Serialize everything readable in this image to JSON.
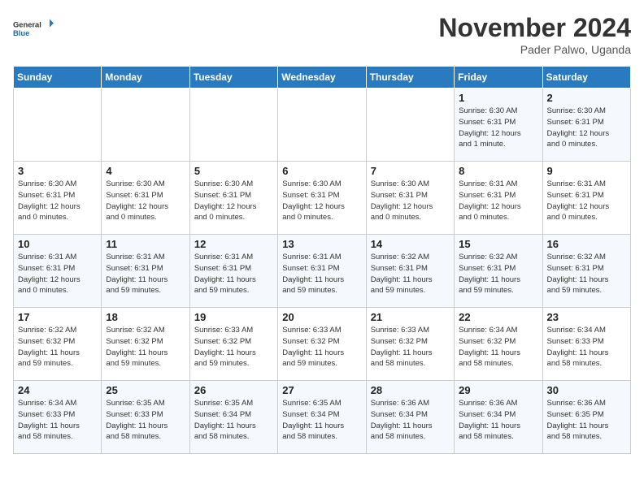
{
  "header": {
    "logo_line1": "General",
    "logo_line2": "Blue",
    "month_title": "November 2024",
    "subtitle": "Pader Palwo, Uganda"
  },
  "weekdays": [
    "Sunday",
    "Monday",
    "Tuesday",
    "Wednesday",
    "Thursday",
    "Friday",
    "Saturday"
  ],
  "weeks": [
    [
      {
        "day": "",
        "info": ""
      },
      {
        "day": "",
        "info": ""
      },
      {
        "day": "",
        "info": ""
      },
      {
        "day": "",
        "info": ""
      },
      {
        "day": "",
        "info": ""
      },
      {
        "day": "1",
        "info": "Sunrise: 6:30 AM\nSunset: 6:31 PM\nDaylight: 12 hours\nand 1 minute."
      },
      {
        "day": "2",
        "info": "Sunrise: 6:30 AM\nSunset: 6:31 PM\nDaylight: 12 hours\nand 0 minutes."
      }
    ],
    [
      {
        "day": "3",
        "info": "Sunrise: 6:30 AM\nSunset: 6:31 PM\nDaylight: 12 hours\nand 0 minutes."
      },
      {
        "day": "4",
        "info": "Sunrise: 6:30 AM\nSunset: 6:31 PM\nDaylight: 12 hours\nand 0 minutes."
      },
      {
        "day": "5",
        "info": "Sunrise: 6:30 AM\nSunset: 6:31 PM\nDaylight: 12 hours\nand 0 minutes."
      },
      {
        "day": "6",
        "info": "Sunrise: 6:30 AM\nSunset: 6:31 PM\nDaylight: 12 hours\nand 0 minutes."
      },
      {
        "day": "7",
        "info": "Sunrise: 6:30 AM\nSunset: 6:31 PM\nDaylight: 12 hours\nand 0 minutes."
      },
      {
        "day": "8",
        "info": "Sunrise: 6:31 AM\nSunset: 6:31 PM\nDaylight: 12 hours\nand 0 minutes."
      },
      {
        "day": "9",
        "info": "Sunrise: 6:31 AM\nSunset: 6:31 PM\nDaylight: 12 hours\nand 0 minutes."
      }
    ],
    [
      {
        "day": "10",
        "info": "Sunrise: 6:31 AM\nSunset: 6:31 PM\nDaylight: 12 hours\nand 0 minutes."
      },
      {
        "day": "11",
        "info": "Sunrise: 6:31 AM\nSunset: 6:31 PM\nDaylight: 11 hours\nand 59 minutes."
      },
      {
        "day": "12",
        "info": "Sunrise: 6:31 AM\nSunset: 6:31 PM\nDaylight: 11 hours\nand 59 minutes."
      },
      {
        "day": "13",
        "info": "Sunrise: 6:31 AM\nSunset: 6:31 PM\nDaylight: 11 hours\nand 59 minutes."
      },
      {
        "day": "14",
        "info": "Sunrise: 6:32 AM\nSunset: 6:31 PM\nDaylight: 11 hours\nand 59 minutes."
      },
      {
        "day": "15",
        "info": "Sunrise: 6:32 AM\nSunset: 6:31 PM\nDaylight: 11 hours\nand 59 minutes."
      },
      {
        "day": "16",
        "info": "Sunrise: 6:32 AM\nSunset: 6:31 PM\nDaylight: 11 hours\nand 59 minutes."
      }
    ],
    [
      {
        "day": "17",
        "info": "Sunrise: 6:32 AM\nSunset: 6:32 PM\nDaylight: 11 hours\nand 59 minutes."
      },
      {
        "day": "18",
        "info": "Sunrise: 6:32 AM\nSunset: 6:32 PM\nDaylight: 11 hours\nand 59 minutes."
      },
      {
        "day": "19",
        "info": "Sunrise: 6:33 AM\nSunset: 6:32 PM\nDaylight: 11 hours\nand 59 minutes."
      },
      {
        "day": "20",
        "info": "Sunrise: 6:33 AM\nSunset: 6:32 PM\nDaylight: 11 hours\nand 59 minutes."
      },
      {
        "day": "21",
        "info": "Sunrise: 6:33 AM\nSunset: 6:32 PM\nDaylight: 11 hours\nand 58 minutes."
      },
      {
        "day": "22",
        "info": "Sunrise: 6:34 AM\nSunset: 6:32 PM\nDaylight: 11 hours\nand 58 minutes."
      },
      {
        "day": "23",
        "info": "Sunrise: 6:34 AM\nSunset: 6:33 PM\nDaylight: 11 hours\nand 58 minutes."
      }
    ],
    [
      {
        "day": "24",
        "info": "Sunrise: 6:34 AM\nSunset: 6:33 PM\nDaylight: 11 hours\nand 58 minutes."
      },
      {
        "day": "25",
        "info": "Sunrise: 6:35 AM\nSunset: 6:33 PM\nDaylight: 11 hours\nand 58 minutes."
      },
      {
        "day": "26",
        "info": "Sunrise: 6:35 AM\nSunset: 6:34 PM\nDaylight: 11 hours\nand 58 minutes."
      },
      {
        "day": "27",
        "info": "Sunrise: 6:35 AM\nSunset: 6:34 PM\nDaylight: 11 hours\nand 58 minutes."
      },
      {
        "day": "28",
        "info": "Sunrise: 6:36 AM\nSunset: 6:34 PM\nDaylight: 11 hours\nand 58 minutes."
      },
      {
        "day": "29",
        "info": "Sunrise: 6:36 AM\nSunset: 6:34 PM\nDaylight: 11 hours\nand 58 minutes."
      },
      {
        "day": "30",
        "info": "Sunrise: 6:36 AM\nSunset: 6:35 PM\nDaylight: 11 hours\nand 58 minutes."
      }
    ]
  ]
}
